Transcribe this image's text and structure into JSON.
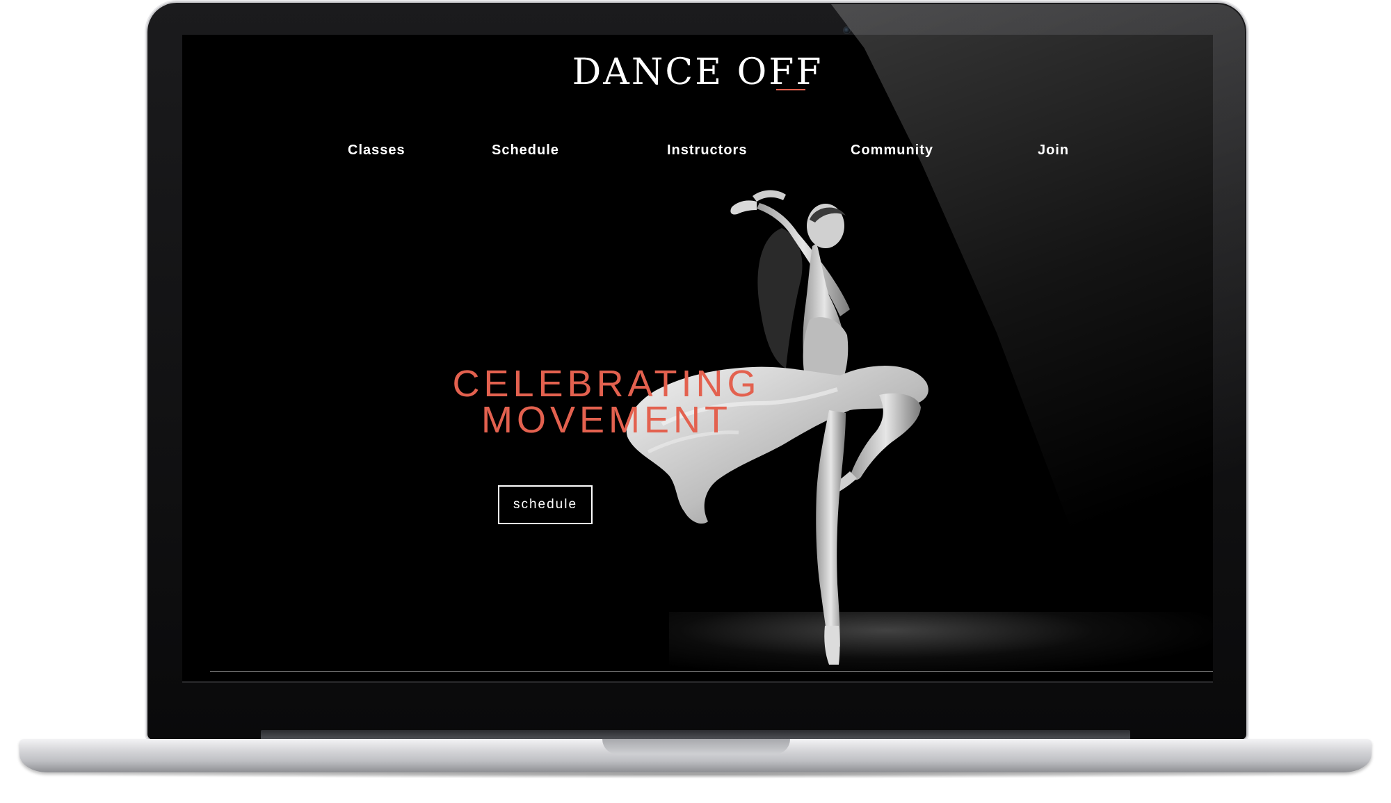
{
  "site": {
    "logo_text": "DANCE OFF"
  },
  "nav": {
    "items": [
      {
        "label": "Classes"
      },
      {
        "label": "Schedule"
      },
      {
        "label": "Instructors"
      },
      {
        "label": "Community"
      },
      {
        "label": "Join"
      }
    ]
  },
  "hero": {
    "title_line1": "CELEBRATING",
    "title_line2": "MOVEMENT",
    "cta_label": "schedule"
  },
  "colors": {
    "accent": "#e3614f",
    "background": "#000000",
    "text": "#ffffff"
  }
}
